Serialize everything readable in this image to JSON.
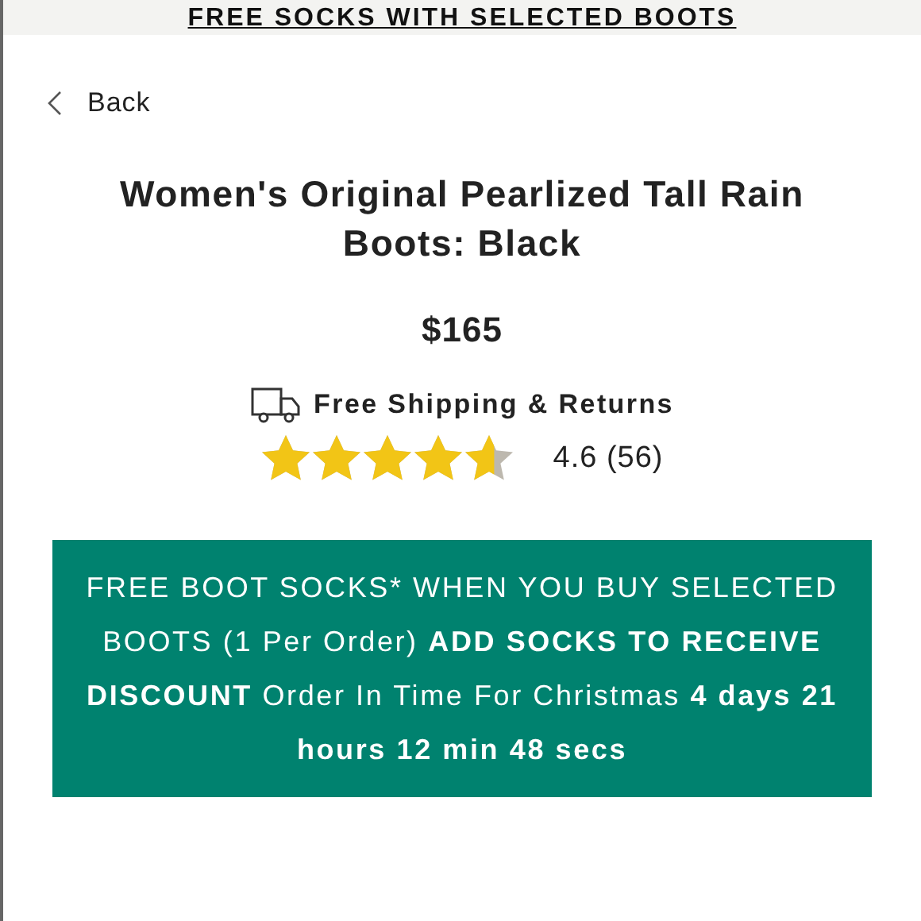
{
  "promo_banner": {
    "text": "FREE SOCKS WITH SELECTED BOOTS"
  },
  "back_link": {
    "label": "Back"
  },
  "product": {
    "title": "Women's Original Pearlized Tall Rain Boots: Black",
    "price": "$165",
    "shipping": "Free Shipping & Returns",
    "stars": 4.6,
    "rating": "4.6 (56)"
  },
  "offer": {
    "text": "FREE BOOT SOCKS* WHEN YOU BUY SELECTED BOOTS (1 Per Order) **ADD SOCKS TO RECEIVE DISCOUNT** Order In Time For Christmas **4 days 21 hours 12 min 48 secs**"
  }
}
